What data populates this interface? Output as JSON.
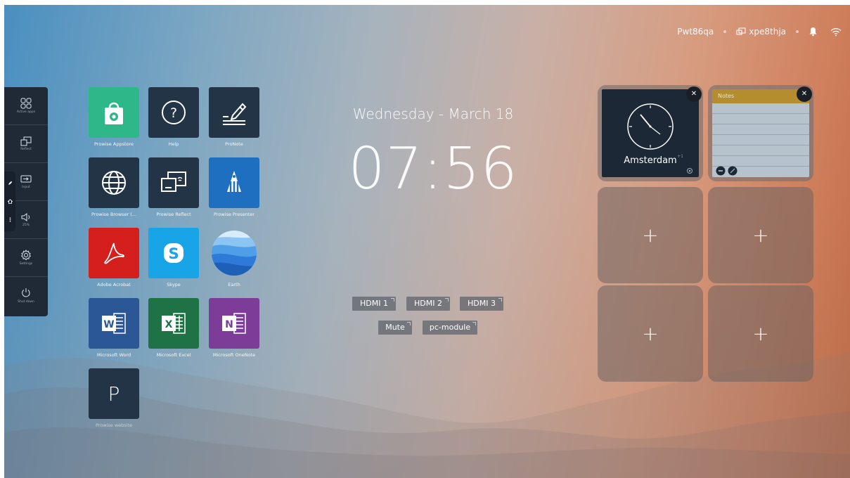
{
  "status_bar": {
    "device_name": "Pwt86qa",
    "cast_code": "xpe8thja",
    "icons": [
      "cast-icon",
      "bell-icon",
      "wifi-icon"
    ]
  },
  "sidebar": {
    "items": [
      {
        "icon": "active-apps-icon",
        "label": "Active apps"
      },
      {
        "icon": "reflect-icon",
        "label": "Reflect"
      },
      {
        "icon": "input-icon",
        "label": "Input"
      },
      {
        "icon": "volume-icon",
        "label": "25%"
      },
      {
        "icon": "gear-icon",
        "label": "Settings"
      },
      {
        "icon": "power-icon",
        "label": "Shut down"
      }
    ],
    "tab_icons": [
      "pencil-icon",
      "home-icon",
      "menu-icon"
    ]
  },
  "apps": [
    {
      "name": "Prowise Appstore",
      "icon": "appstore-bag-icon",
      "color": "#2eb88a"
    },
    {
      "name": "Help",
      "icon": "help-icon",
      "color": "#243447"
    },
    {
      "name": "ProNote",
      "icon": "pronote-pen-icon",
      "color": "#243447"
    },
    {
      "name": "Prowise Browser (...",
      "icon": "globe-icon",
      "color": "#243447"
    },
    {
      "name": "Prowise Reflect",
      "icon": "reflect-icon",
      "color": "#243447"
    },
    {
      "name": "Prowise Presenter",
      "icon": "presenter-icon",
      "color": "#1f6fc1"
    },
    {
      "name": "Adobe Acrobat",
      "icon": "acrobat-icon",
      "color": "#d41f1c"
    },
    {
      "name": "Skype",
      "icon": "skype-icon",
      "color": "#18a5e8"
    },
    {
      "name": "Earth",
      "icon": "earth-icon",
      "color": "#4a8fe0"
    },
    {
      "name": "Microsoft Word",
      "icon": "word-icon",
      "color": "#2b5797"
    },
    {
      "name": "Microsoft Excel",
      "icon": "excel-icon",
      "color": "#1f7245"
    },
    {
      "name": "Microsoft OneNote",
      "icon": "onenote-icon",
      "color": "#7d3c98"
    },
    {
      "name": "Prowise website",
      "icon": "p-letter-icon",
      "color": "#243447",
      "letter": "P"
    }
  ],
  "clock": {
    "date": "Wednesday - March 18",
    "time": "07:56"
  },
  "sources": {
    "row1": [
      "HDMI 1",
      "HDMI 2",
      "HDMI 3"
    ],
    "row2": [
      "Mute",
      "pc-module"
    ]
  },
  "widgets": {
    "clock_widget": {
      "city": "Amsterdam",
      "offset": "+1"
    },
    "notes_widget": {
      "title": "Notes"
    },
    "add_label": "+"
  }
}
